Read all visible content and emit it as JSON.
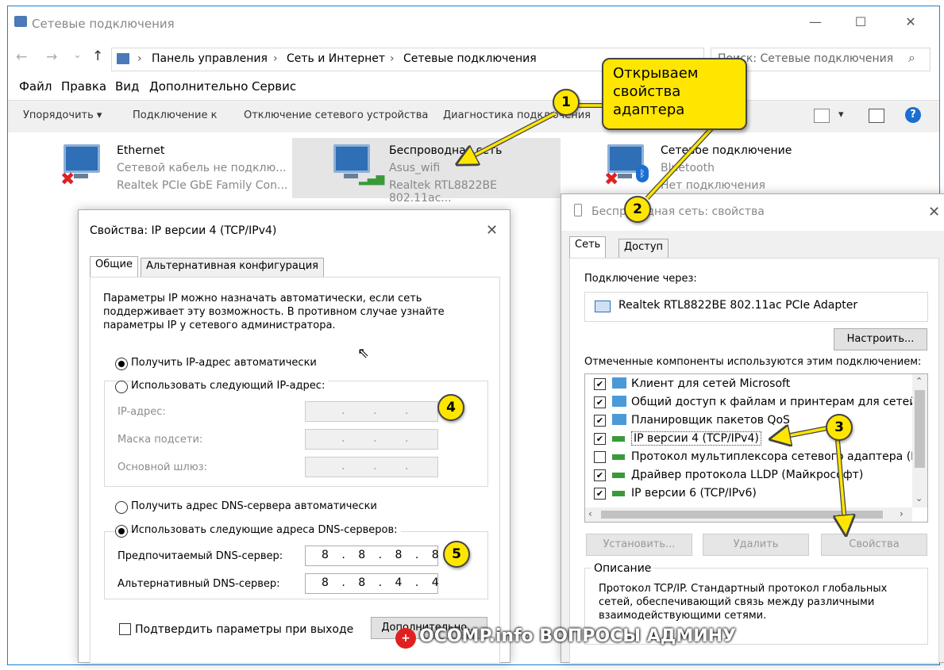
{
  "window": {
    "title": "Сетевые подключения",
    "minimize": "—",
    "maximize": "☐",
    "close": "✕"
  },
  "address": {
    "back": "←",
    "forward": "→",
    "dropdown": "⌄",
    "up": "↑",
    "crumbs": [
      "Панель управления",
      "Сеть и Интернет",
      "Сетевые подключения"
    ],
    "separator": "›",
    "search_placeholder": "Поиск: Сетевые подключения"
  },
  "menu": [
    "Файл",
    "Правка",
    "Вид",
    "Дополнительно",
    "Сервис"
  ],
  "commands": {
    "organize": "Упорядочить ▾",
    "connect": "Подключение к",
    "disable": "Отключение сетевого устройства",
    "diagnose": "Диагностика подключения",
    "help": "?"
  },
  "adapters": [
    {
      "name": "Ethernet",
      "status": "Сетевой кабель не подклю...",
      "device": "Realtek PCIe GbE Family Con..."
    },
    {
      "name": "Беспроводная сеть",
      "status": "Asus_wifi",
      "device": "Realtek RTL8822BE 802.11ac..."
    },
    {
      "name": "Сетевое подключение",
      "status": "Bluetooth",
      "device": "Нет подключения"
    }
  ],
  "ipv4": {
    "title": "Свойства: IP версии 4 (TCP/IPv4)",
    "tabs": [
      "Общие",
      "Альтернативная конфигурация"
    ],
    "intro": "Параметры IP можно назначать автоматически, если сеть поддерживает эту возможность. В противном случае узнайте параметры IP у сетевого администратора.",
    "auto_ip": "Получить IP-адрес автоматически",
    "manual_ip": "Использовать следующий IP-адрес:",
    "ip_label": "IP-адрес:",
    "mask_label": "Маска подсети:",
    "gateway_label": "Основной шлюз:",
    "auto_dns": "Получить адрес DNS-сервера автоматически",
    "manual_dns": "Использовать следующие адреса DNS-серверов:",
    "preferred_dns_label": "Предпочитаемый DNS-сервер:",
    "preferred_dns": "8 . 8 . 8 . 8",
    "alternate_dns_label": "Альтернативный DNS-сервер:",
    "alternate_dns": "8 . 8 . 4 . 4",
    "validate": "Подтвердить параметры при выходе",
    "advanced": "Дополнительно..."
  },
  "wifi_props": {
    "title": "Беспроводная сеть: свойства",
    "tabs": [
      "Сеть",
      "Доступ"
    ],
    "connect_using": "Подключение через:",
    "adapter": "Realtek RTL8822BE 802.11ac PCIe Adapter",
    "configure": "Настроить...",
    "components_label": "Отмеченные компоненты используются этим подключением:",
    "components": [
      {
        "label": "Клиент для сетей Microsoft",
        "checked": true
      },
      {
        "label": "Общий доступ к файлам и принтерам для сетей Mi",
        "checked": true
      },
      {
        "label": "Планировщик пакетов QoS",
        "checked": true
      },
      {
        "label": "IP версии 4 (TCP/IPv4)",
        "checked": true
      },
      {
        "label": "Протокол мультиплексора сетевого адаптера (Май",
        "checked": false
      },
      {
        "label": "Драйвер протокола LLDP (Майкрософт)",
        "checked": true
      },
      {
        "label": "IP версии 6 (TCP/IPv6)",
        "checked": true
      }
    ],
    "install": "Установить...",
    "remove": "Удалить",
    "properties": "Свойства",
    "description_label": "Описание",
    "description": "Протокол TCP/IP. Стандартный протокол глобальных сетей, обеспечивающий связь между различными взаимодействующими сетями."
  },
  "annotations": {
    "callout": "Открываем свойства адаптера",
    "badges": [
      "1",
      "2",
      "3",
      "4",
      "5"
    ]
  },
  "watermark": "OCOMP.info ВОПРОСЫ АДМИНУ",
  "colors": {
    "accent": "#1883d7",
    "callout": "#ffe600",
    "selection": "#e5e5e5"
  }
}
